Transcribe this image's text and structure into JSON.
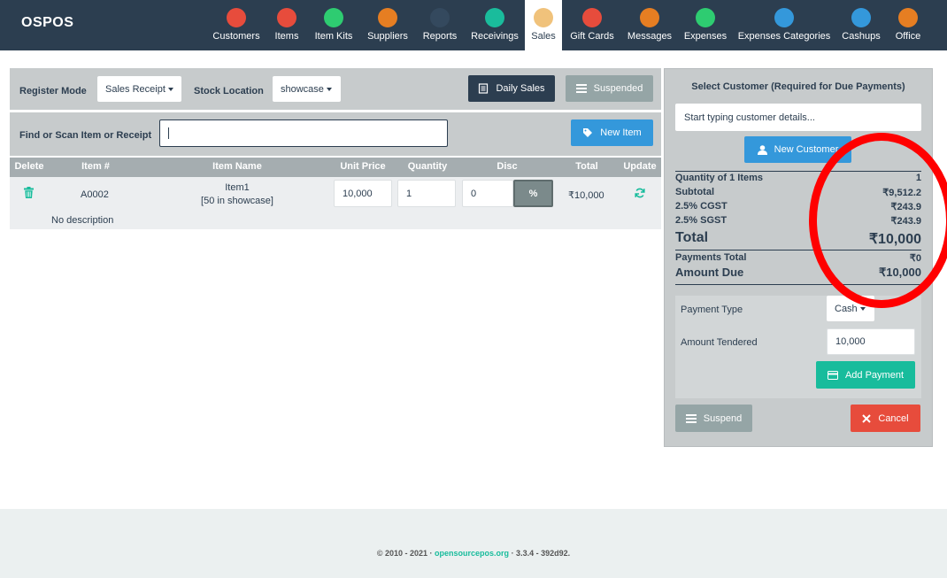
{
  "app": {
    "brand": "OSPOS"
  },
  "nav": [
    {
      "label": "Customers",
      "icon": "customers-icon",
      "color": "#e74c3c"
    },
    {
      "label": "Items",
      "icon": "items-icon",
      "color": "#e74c3c"
    },
    {
      "label": "Item Kits",
      "icon": "item-kits-icon",
      "color": "#2ecc71"
    },
    {
      "label": "Suppliers",
      "icon": "suppliers-icon",
      "color": "#e67e22"
    },
    {
      "label": "Reports",
      "icon": "reports-icon",
      "color": "#34495e"
    },
    {
      "label": "Receivings",
      "icon": "receivings-icon",
      "color": "#1abc9c"
    },
    {
      "label": "Sales",
      "icon": "sales-icon",
      "color": "#f0c27b"
    },
    {
      "label": "Gift Cards",
      "icon": "gift-cards-icon",
      "color": "#e74c3c"
    },
    {
      "label": "Messages",
      "icon": "messages-icon",
      "color": "#e67e22"
    },
    {
      "label": "Expenses",
      "icon": "expenses-icon",
      "color": "#2ecc71"
    },
    {
      "label": "Expenses Categories",
      "icon": "expenses-categories-icon",
      "color": "#3498db"
    },
    {
      "label": "Cashups",
      "icon": "cashups-icon",
      "color": "#3498db"
    },
    {
      "label": "Office",
      "icon": "office-icon",
      "color": "#e67e22"
    }
  ],
  "register": {
    "mode_label": "Register Mode",
    "mode_value": "Sales Receipt",
    "location_label": "Stock Location",
    "location_value": "showcase",
    "daily_sales": "Daily Sales",
    "suspended": "Suspended",
    "find_label": "Find or Scan Item or Receipt",
    "new_item": "New Item"
  },
  "table": {
    "headers": [
      "Delete",
      "Item #",
      "Item Name",
      "Unit Price",
      "Quantity",
      "Disc",
      "Total",
      "Update"
    ],
    "rows": [
      {
        "item_number": "A0002",
        "item_name": "Item1",
        "stock_note": "[50 in showcase]",
        "unit_price": "10,000",
        "quantity": "1",
        "discount": "0",
        "discount_type": "%",
        "total": "₹10,000",
        "description": "No description"
      }
    ]
  },
  "sidebar": {
    "title": "Select Customer (Required for Due Payments)",
    "customer_placeholder": "Start typing customer details...",
    "new_customer": "New Customer",
    "summary": {
      "quantity_label": "Quantity of 1 Items",
      "quantity_value": "1",
      "subtotal_label": "Subtotal",
      "subtotal_value": "₹9,512.2",
      "cgst_label": "2.5% CGST",
      "cgst_value": "₹243.9",
      "sgst_label": "2.5% SGST",
      "sgst_value": "₹243.9",
      "total_label": "Total",
      "total_value": "₹10,000",
      "payments_label": "Payments Total",
      "payments_value": "₹0",
      "due_label": "Amount Due",
      "due_value": "₹10,000"
    },
    "payment": {
      "type_label": "Payment Type",
      "type_value": "Cash",
      "tendered_label": "Amount Tendered",
      "tendered_value": "10,000",
      "add_payment": "Add Payment"
    },
    "suspend": "Suspend",
    "cancel": "Cancel"
  },
  "footer": {
    "prefix": "© 2010 - 2021 · ",
    "link": "opensourcepos.org",
    "suffix": " · 3.3.4 - 392d92."
  },
  "colors": {
    "navbar": "#2c3e50",
    "primary": "#3498db",
    "success": "#18bc9c",
    "danger": "#e74c3c",
    "dark": "#2c3e50",
    "muted": "#95a5a6",
    "annotation": "#ff0000"
  }
}
